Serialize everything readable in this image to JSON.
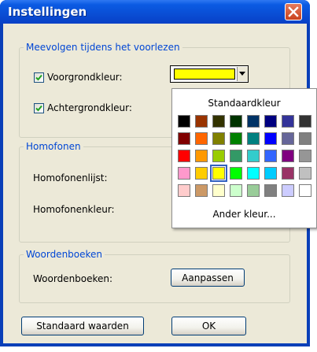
{
  "window": {
    "title": "Instellingen"
  },
  "groups": {
    "follow": {
      "title": "Meevolgen tijdens het voorlezen",
      "foreground_label": "Voorgrondkleur:",
      "background_label": "Achtergrondkleur:",
      "foreground_checked": true,
      "background_checked": true,
      "foreground_color": "#ffff00"
    },
    "homophones": {
      "title": "Homofonen",
      "list_label": "Homofonenlijst:",
      "color_label": "Homofonenkleur:"
    },
    "dictionaries": {
      "title": "Woordenboeken",
      "label": "Woordenboeken:",
      "customize_button": "Aanpassen"
    }
  },
  "footer": {
    "defaults_button": "Standaard waarden",
    "ok_button": "OK"
  },
  "color_popup": {
    "title": "Standaardkleur",
    "more_colors": "Ander kleur...",
    "selected": "#ffff00",
    "rows": [
      [
        "#000000",
        "#993300",
        "#333300",
        "#003300",
        "#003366",
        "#000080",
        "#333399",
        "#333333"
      ],
      [
        "#800000",
        "#ff6600",
        "#808000",
        "#008000",
        "#008080",
        "#0000ff",
        "#666699",
        "#808080"
      ],
      [
        "#ff0000",
        "#ff9900",
        "#99cc00",
        "#339966",
        "#33cccc",
        "#3366ff",
        "#800080",
        "#969696"
      ],
      [
        "#ff99cc",
        "#ffcc00",
        "#ffff00",
        "#00ff00",
        "#00ffff",
        "#00ccff",
        "#993366",
        "#c0c0c0"
      ],
      [
        "#ffcccc",
        "#cc9966",
        "#ffffcc",
        "#ccffcc",
        "#99cc99",
        "#808080",
        "#ccccff",
        "#ffffff"
      ]
    ]
  }
}
